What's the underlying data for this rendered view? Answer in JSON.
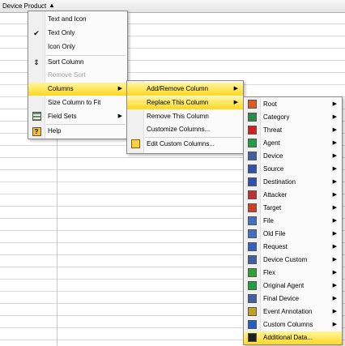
{
  "header": {
    "column_label": "Device Product",
    "sort_glyph": "▲"
  },
  "menu1": {
    "items": [
      {
        "label": "Text and Icon",
        "icon": "none"
      },
      {
        "label": "Text Only",
        "icon": "check-icon"
      },
      {
        "label": "Icon Only",
        "icon": "none"
      },
      {
        "label": "Sort Column",
        "icon": "sort-icon"
      },
      {
        "label": "Remove Sort",
        "icon": "none"
      },
      {
        "label": "Columns",
        "icon": "none"
      },
      {
        "label": "Size Column to Fit",
        "icon": "none"
      },
      {
        "label": "Field Sets",
        "icon": "field-sets-icon"
      },
      {
        "label": "Help",
        "icon": "help-icon"
      }
    ]
  },
  "menu2": {
    "items": [
      {
        "label": "Add/Remove Column"
      },
      {
        "label": "Replace This Column"
      },
      {
        "label": "Remove This Column"
      },
      {
        "label": "Customize Columns..."
      },
      {
        "label": "Edit Custom Columns..."
      }
    ]
  },
  "menu3": {
    "items": [
      {
        "label": "Root",
        "icon": "root-icon",
        "color": "#e05a1a"
      },
      {
        "label": "Category",
        "icon": "category-icon",
        "color": "#2a8a4a"
      },
      {
        "label": "Threat",
        "icon": "threat-icon",
        "color": "#d02020"
      },
      {
        "label": "Agent",
        "icon": "agent-icon",
        "color": "#20a040"
      },
      {
        "label": "Device",
        "icon": "device-icon",
        "color": "#4060a0"
      },
      {
        "label": "Source",
        "icon": "source-icon",
        "color": "#3050b0"
      },
      {
        "label": "Destination",
        "icon": "destination-icon",
        "color": "#3050b0"
      },
      {
        "label": "Attacker",
        "icon": "attacker-icon",
        "color": "#c03030"
      },
      {
        "label": "Target",
        "icon": "target-icon",
        "color": "#d04020"
      },
      {
        "label": "File",
        "icon": "file-icon",
        "color": "#4070c0"
      },
      {
        "label": "Old File",
        "icon": "old-file-icon",
        "color": "#4070c0"
      },
      {
        "label": "Request",
        "icon": "request-icon",
        "color": "#3060c0"
      },
      {
        "label": "Device Custom",
        "icon": "device-custom-icon",
        "color": "#4060a0"
      },
      {
        "label": "Flex",
        "icon": "flex-icon",
        "color": "#30a030"
      },
      {
        "label": "Original Agent",
        "icon": "original-agent-icon",
        "color": "#20a040"
      },
      {
        "label": "Final Device",
        "icon": "final-device-icon",
        "color": "#4060a0"
      },
      {
        "label": "Event Annotation",
        "icon": "event-annotation-icon",
        "color": "#c0a020"
      },
      {
        "label": "Custom Columns",
        "icon": "custom-columns-icon",
        "color": "#2060c0"
      },
      {
        "label": "Additional Data...",
        "icon": "additional-data-icon",
        "color": "#202020"
      }
    ]
  },
  "colors": {
    "highlight": "#ffe033",
    "menu_bg": "#fbfbfb"
  }
}
